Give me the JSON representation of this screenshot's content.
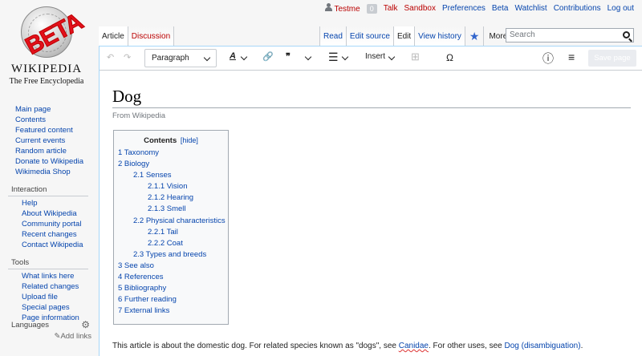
{
  "personal": {
    "username": "Testme",
    "notif_count": "0",
    "talk": "Talk",
    "sandbox": "Sandbox",
    "preferences": "Preferences",
    "beta": "Beta",
    "watchlist": "Watchlist",
    "contributions": "Contributions",
    "logout": "Log out"
  },
  "logo": {
    "stamp": "BETA",
    "wordmark": "WIKIPEDIA",
    "tagline": "The Free Encyclopedia"
  },
  "sidebar": {
    "main": [
      "Main page",
      "Contents",
      "Featured content",
      "Current events",
      "Random article",
      "Donate to Wikipedia",
      "Wikimedia Shop"
    ],
    "interaction_title": "Interaction",
    "interaction": [
      "Help",
      "About Wikipedia",
      "Community portal",
      "Recent changes",
      "Contact Wikipedia"
    ],
    "tools_title": "Tools",
    "tools": [
      "What links here",
      "Related changes",
      "Upload file",
      "Special pages",
      "Page information"
    ],
    "languages_title": "Languages",
    "add_links": "Add links"
  },
  "tabs": {
    "article": "Article",
    "discussion": "Discussion",
    "read": "Read",
    "edit_source": "Edit source",
    "edit": "Edit",
    "view_history": "View history",
    "more": "More"
  },
  "search": {
    "placeholder": "Search"
  },
  "toolbar": {
    "paragraph": "Paragraph",
    "insert": "Insert",
    "save": "Save page",
    "special_char": "Ω"
  },
  "article": {
    "title": "Dog",
    "from": "From Wikipedia",
    "lead_1": "This article is about the domestic dog. For related species known as \"dogs\", see ",
    "lead_link_1": "Canidae",
    "lead_2": ". For other uses, see ",
    "lead_link_2": "Dog (disambiguation)",
    "lead_3": "."
  },
  "toc": {
    "title": "Contents",
    "hide": "[hide]",
    "items": [
      {
        "level": 1,
        "text": "1 Taxonomy"
      },
      {
        "level": 1,
        "text": "2 Biology"
      },
      {
        "level": 2,
        "text": "2.1 Senses"
      },
      {
        "level": 3,
        "text": "2.1.1 Vision"
      },
      {
        "level": 3,
        "text": "2.1.2 Hearing"
      },
      {
        "level": 3,
        "text": "2.1.3 Smell"
      },
      {
        "level": 2,
        "text": "2.2 Physical characteristics"
      },
      {
        "level": 3,
        "text": "2.2.1 Tail"
      },
      {
        "level": 3,
        "text": "2.2.2 Coat"
      },
      {
        "level": 2,
        "text": "2.3 Types and breeds"
      },
      {
        "level": 1,
        "text": "3 See also"
      },
      {
        "level": 1,
        "text": "4 References"
      },
      {
        "level": 1,
        "text": "5 Bibliography"
      },
      {
        "level": 1,
        "text": "6 Further reading"
      },
      {
        "level": 1,
        "text": "7 External links"
      }
    ]
  },
  "colors": {
    "link": "#0645ad",
    "red_link": "#ba0000",
    "stamp": "#e3101b",
    "border": "#a7d7f9"
  }
}
